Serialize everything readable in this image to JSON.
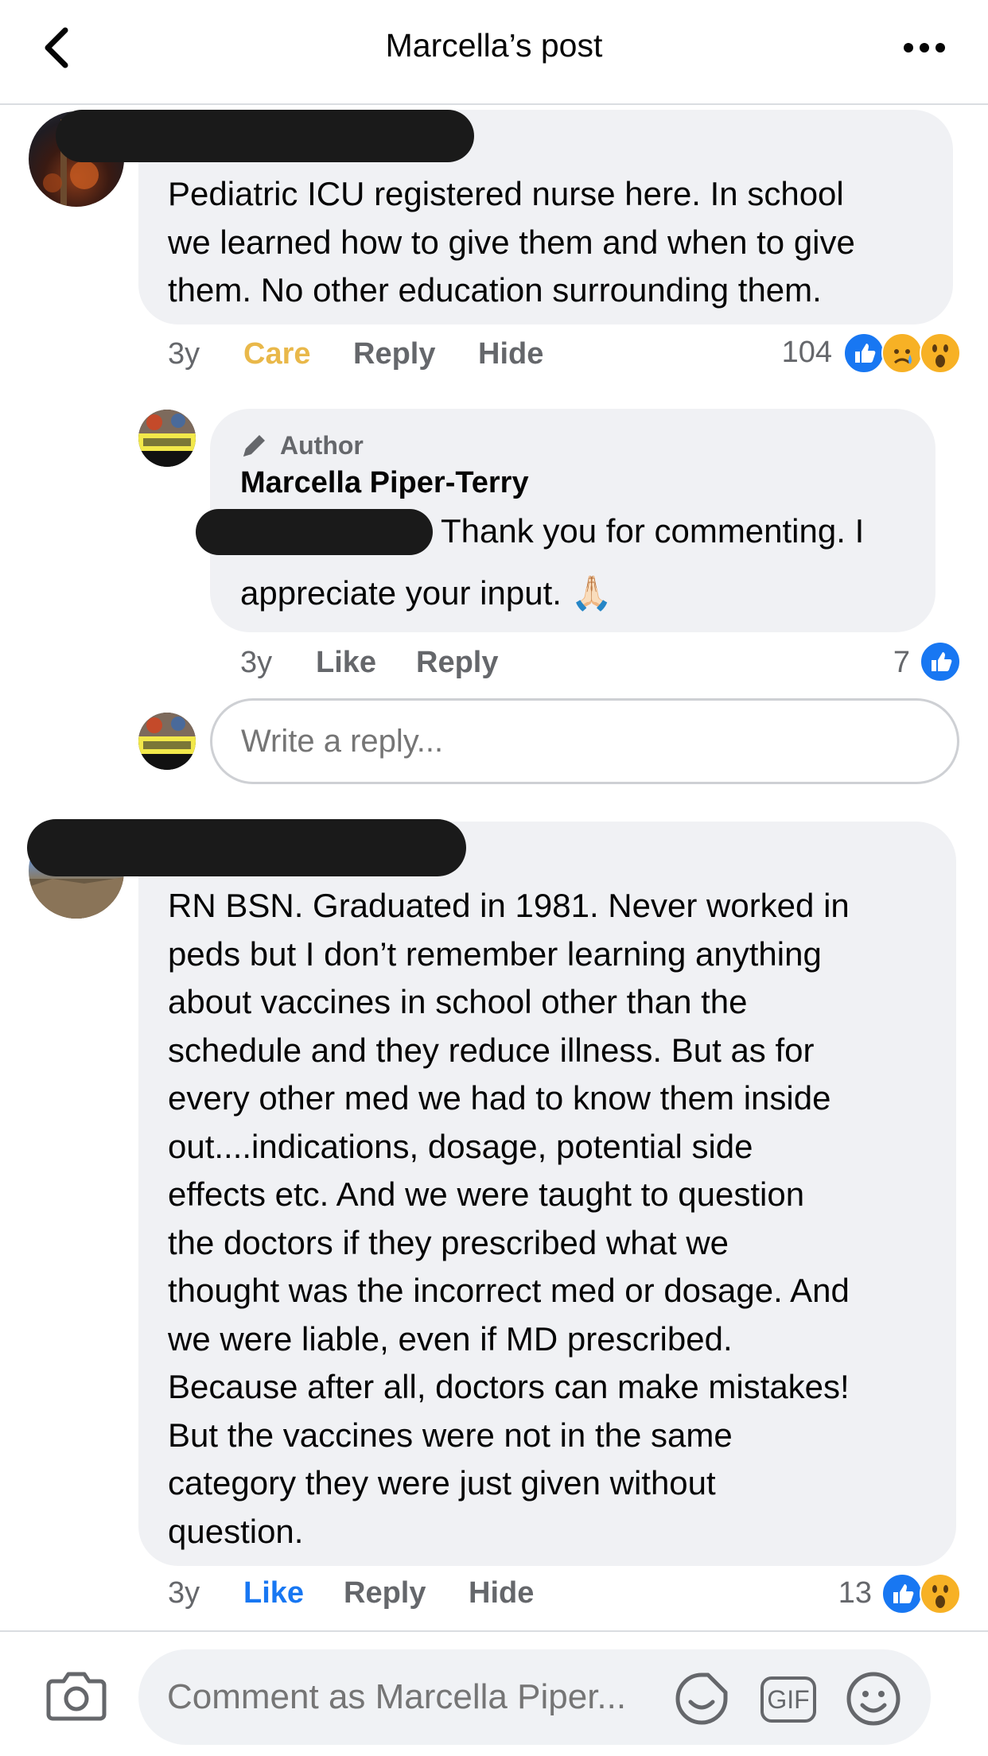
{
  "header": {
    "title": "Marcella’s post"
  },
  "comments": [
    {
      "text_lines": [
        "Pediatric ICU registered nurse here. In school",
        "we learned how to give them and when to give",
        "them. No other education surrounding them."
      ],
      "time": "3y",
      "reaction_action": "Care",
      "reply_label": "Reply",
      "hide_label": "Hide",
      "reaction_count": "104",
      "reactions": [
        "like-icon",
        "care-icon",
        "wow-icon"
      ],
      "reply": {
        "badge": "Author",
        "author": "Marcella Piper-Terry",
        "text_line1": "Thank you for commenting. I",
        "text_line2": "appreciate your input. 🙏🏻",
        "time": "3y",
        "like_label": "Like",
        "reply_label": "Reply",
        "reaction_count": "7"
      },
      "reply_input_placeholder": "Write a reply..."
    },
    {
      "text_lines": [
        "RN BSN. Graduated in 1981. Never worked in",
        "peds but I don’t remember learning anything",
        "about vaccines in school other than the",
        "schedule and they reduce illness. But as for",
        "every other med we had to know them inside",
        "out....indications, dosage, potential side",
        "effects etc. And we were taught to question",
        "the doctors if they prescribed what we",
        "thought was the incorrect med or dosage. And",
        "we were liable, even if MD prescribed.",
        "Because after all, doctors can make mistakes!",
        "But the vaccines were not in the same",
        "category they were just given without",
        "question."
      ],
      "time": "3y",
      "reaction_action": "Like",
      "reply_label": "Reply",
      "hide_label": "Hide",
      "reaction_count": "13",
      "reactions": [
        "like-icon",
        "wow-icon"
      ]
    }
  ],
  "composer": {
    "placeholder": "Comment as Marcella Piper...",
    "gif_label": "GIF"
  },
  "colors": {
    "care": "#e9b84a",
    "like_active": "#1877f2",
    "muted": "#65676b",
    "bubble": "#f0f1f4"
  }
}
